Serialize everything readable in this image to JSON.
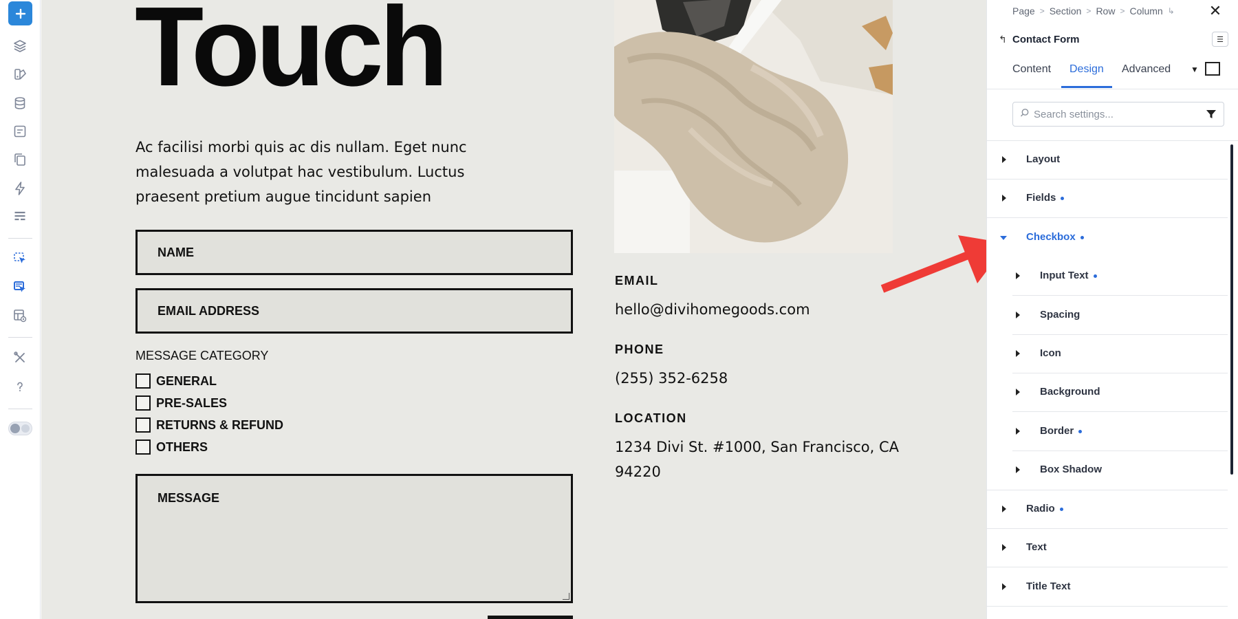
{
  "canvas": {
    "hero_title": "Touch",
    "intro": "Ac facilisi morbi quis ac dis nullam. Eget nunc malesuada a volutpat hac vestibulum. Luctus praesent pretium augue tincidunt sapien",
    "form": {
      "name_placeholder": "NAME",
      "email_placeholder": "EMAIL ADDRESS",
      "message_category_label": "MESSAGE CATEGORY",
      "checkboxes": [
        "GENERAL",
        "PRE-SALES",
        "RETURNS & REFUND",
        "OTHERS"
      ],
      "message_placeholder": "MESSAGE"
    },
    "contact": {
      "email_label": "EMAIL",
      "email_value": "hello@divihomegoods.com",
      "phone_label": "PHONE",
      "phone_value": "(255) 352-6258",
      "location_label": "LOCATION",
      "location_value": "1234 Divi St. #1000, San Francisco, CA 94220"
    }
  },
  "panel": {
    "breadcrumb": [
      "Page",
      "Section",
      "Row",
      "Column"
    ],
    "module_title": "Contact Form",
    "tabs": [
      "Content",
      "Design",
      "Advanced"
    ],
    "active_tab": "Design",
    "search_placeholder": "Search settings...",
    "groups": [
      {
        "label": "Layout",
        "modified": false
      },
      {
        "label": "Fields",
        "modified": true
      },
      {
        "label": "Checkbox",
        "modified": true,
        "expanded": true
      },
      {
        "label": "Radio",
        "modified": true
      },
      {
        "label": "Text",
        "modified": false
      },
      {
        "label": "Title Text",
        "modified": false
      }
    ],
    "checkbox_subgroups": [
      {
        "label": "Input Text",
        "modified": true
      },
      {
        "label": "Spacing",
        "modified": false
      },
      {
        "label": "Icon",
        "modified": false
      },
      {
        "label": "Background",
        "modified": false
      },
      {
        "label": "Border",
        "modified": true
      },
      {
        "label": "Box Shadow",
        "modified": false
      }
    ]
  },
  "colors": {
    "accent": "#2b6cda",
    "add_button": "#2b87da",
    "canvas_bg": "#e9e9e5",
    "annotation_arrow": "#ef3b36"
  }
}
